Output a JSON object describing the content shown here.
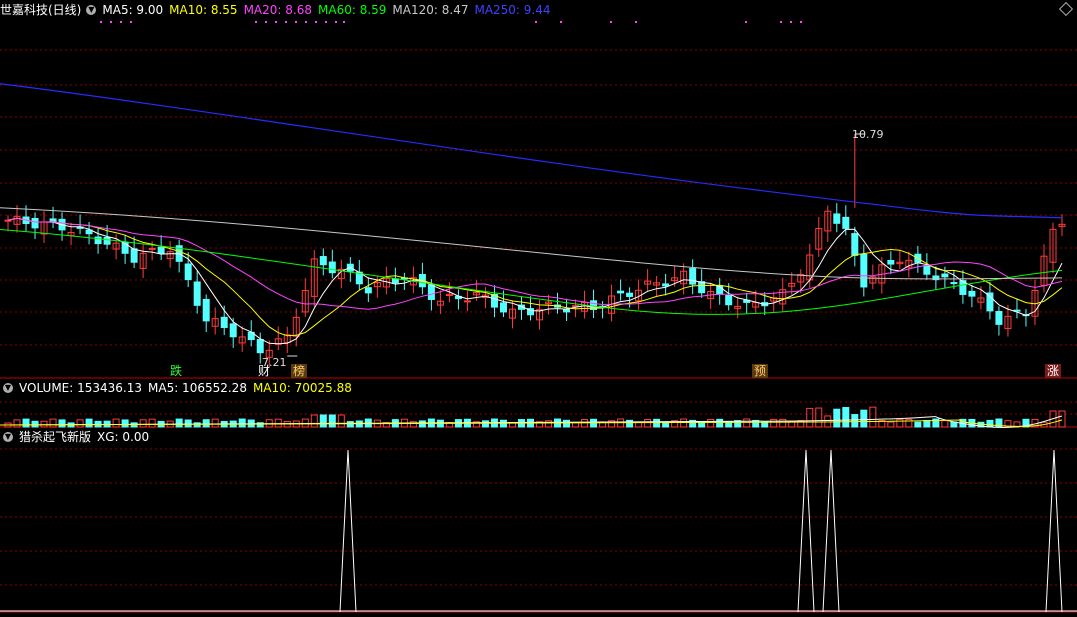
{
  "main_panel": {
    "title": "世嘉科技(日线)",
    "ma5": "MA5: 9.00",
    "ma10": "MA10: 8.55",
    "ma20": "MA20: 8.68",
    "ma60": "MA60: 8.59",
    "ma120": "MA120: 8.47",
    "ma250": "MA250: 9.44",
    "high_label": "10.79",
    "low_label": "7.21",
    "markers": [
      {
        "text": "跌",
        "color": "#33ff33"
      },
      {
        "text": "财",
        "color": "#ffffff"
      },
      {
        "text": "榜",
        "color": "#ffcc66"
      },
      {
        "text": "预",
        "color": "#ffcc66"
      },
      {
        "text": "涨",
        "color": "#ffffff"
      }
    ]
  },
  "volume_panel": {
    "volume": "VOLUME: 153436.13",
    "ma5": "MA5: 106552.28",
    "ma10": "MA10: 70025.88"
  },
  "indicator_panel": {
    "name": "猎杀起飞新版",
    "xg": "XG: 0.00"
  },
  "colors": {
    "up": "#ff3c3c",
    "down": "#54ffff",
    "ma5": "#ffffff",
    "ma10": "#ffff00",
    "ma20": "#ff44ff",
    "ma60": "#00ff00",
    "ma120": "#c8c8c8",
    "ma250": "#2a2aff",
    "grid": "#8b0000"
  }
}
